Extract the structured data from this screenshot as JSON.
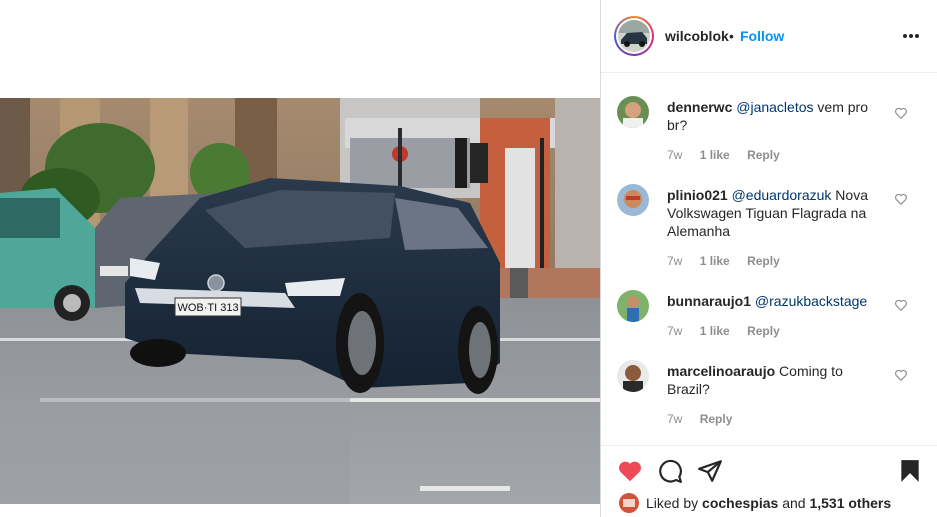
{
  "post": {
    "username": "wilcoblok",
    "separator": "•",
    "follow_label": "Follow",
    "image_plate_text": "WOB·TI 313"
  },
  "comments": [
    {
      "user": "dennerwc",
      "mention": "@janacletos",
      "text": " vem pro br?",
      "age": "7w",
      "likes": "1 like",
      "reply": "Reply"
    },
    {
      "user": "plinio021",
      "mention": "@eduardorazuk",
      "text": " Nova Volkswagen Tiguan Flagrada na Alemanha",
      "age": "7w",
      "likes": "1 like",
      "reply": "Reply"
    },
    {
      "user": "bunnaraujo1",
      "mention": "@razukbackstage",
      "text": "",
      "age": "7w",
      "likes": "1 like",
      "reply": "Reply"
    },
    {
      "user": "marcelinoaraujo",
      "mention": "",
      "text": " Coming to Brazil?",
      "age": "7w",
      "likes": "",
      "reply": "Reply"
    }
  ],
  "likes": {
    "prefix": "Liked by",
    "user": "cochespias",
    "and": "and",
    "others": "1,531 others"
  },
  "icons": {
    "like": "heart-filled-icon",
    "comment": "comment-bubble-icon",
    "share": "paper-plane-icon",
    "save": "bookmark-filled-icon",
    "more": "more-options-icon"
  },
  "colors": {
    "follow": "#0095f6",
    "liked_heart": "#ed4956",
    "text": "#262626",
    "muted": "#8e8e8e",
    "mention": "#00376b"
  }
}
